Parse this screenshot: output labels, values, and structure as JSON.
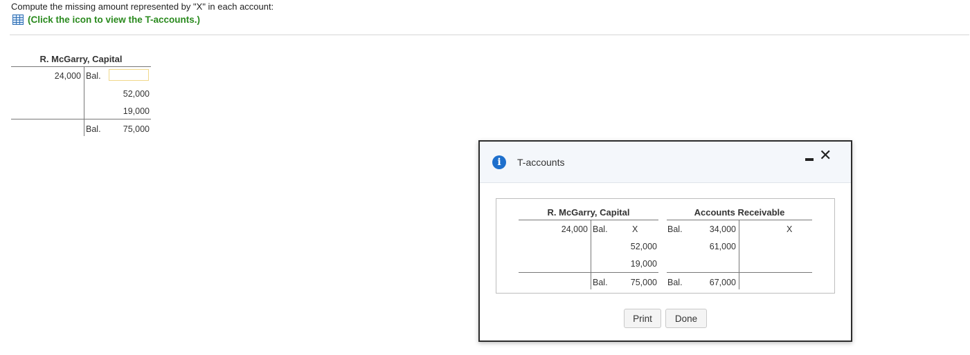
{
  "instruction": "Compute the missing amount represented by \"X\" in each account:",
  "link_text": "(Click the icon to view the T-accounts.)",
  "main_taccount": {
    "title": "R. McGarry, Capital",
    "debit_top": "24,000",
    "bal_label": "Bal.",
    "credit_values": [
      "52,000",
      "19,000"
    ],
    "bottom_bal_label": "Bal.",
    "bottom_bal_value": "75,000"
  },
  "dialog": {
    "title": "T-accounts",
    "capital": {
      "title": "R. McGarry, Capital",
      "debit_top": "24,000",
      "bal_label": "Bal.",
      "x_value": "X",
      "credit_values": [
        "52,000",
        "19,000"
      ],
      "bottom_bal_label": "Bal.",
      "bottom_bal_value": "75,000"
    },
    "receivable": {
      "title": "Accounts Receivable",
      "bal_label": "Bal.",
      "debit_values": [
        "34,000",
        "61,000"
      ],
      "x_value": "X",
      "bottom_bal_label": "Bal.",
      "bottom_bal_value": "67,000"
    },
    "print_label": "Print",
    "done_label": "Done"
  },
  "icons": {
    "grid": "table-grid-icon",
    "info": "info-icon",
    "minimize": "minimize-icon",
    "close": "close-icon"
  },
  "colors": {
    "link_green": "#2a8a1e",
    "info_blue": "#1e6fcc",
    "answer_border": "#f0d88a"
  }
}
